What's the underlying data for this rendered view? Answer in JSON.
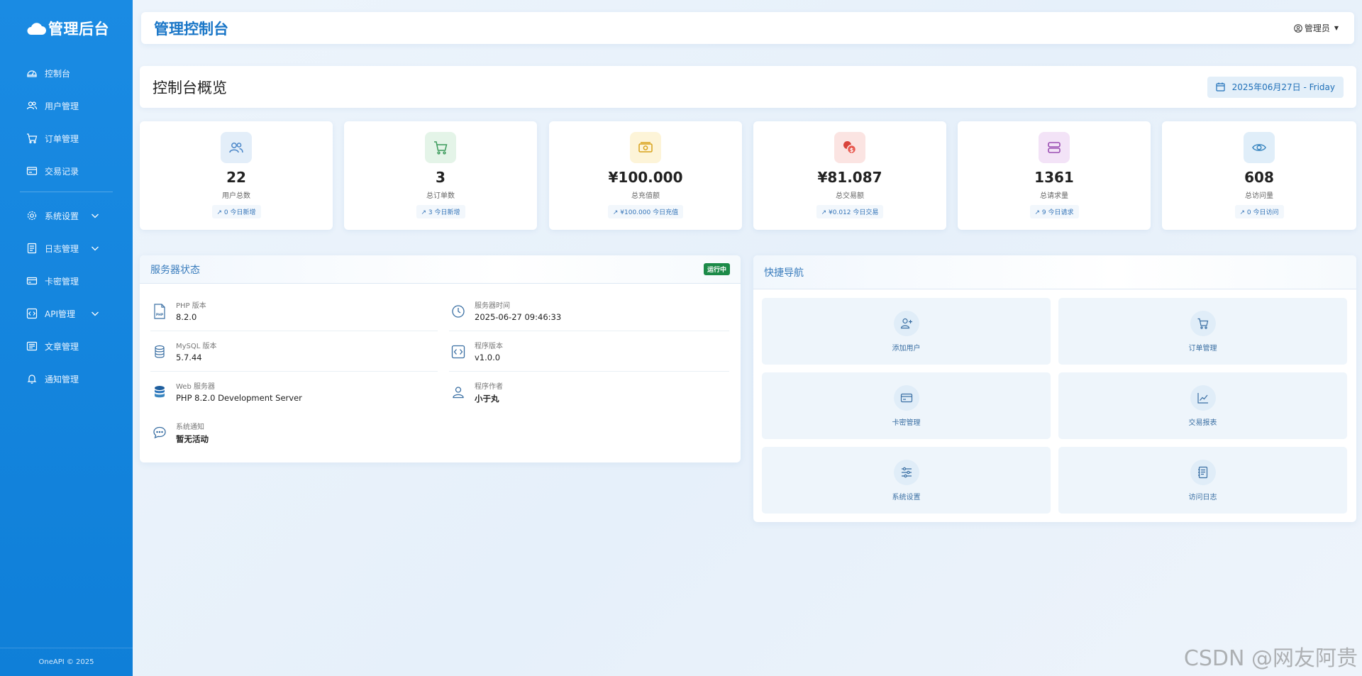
{
  "brand": {
    "title": "管理后台"
  },
  "sidebar": {
    "items": [
      {
        "label": "控制台",
        "icon": "dashboard-icon"
      },
      {
        "label": "用户管理",
        "icon": "users-icon"
      },
      {
        "label": "订单管理",
        "icon": "cart-icon"
      },
      {
        "label": "交易记录",
        "icon": "transaction-icon"
      },
      {
        "label": "系统设置",
        "icon": "gear-icon",
        "expandable": true
      },
      {
        "label": "日志管理",
        "icon": "log-icon",
        "expandable": true
      },
      {
        "label": "卡密管理",
        "icon": "card-icon"
      },
      {
        "label": "API管理",
        "icon": "api-icon",
        "expandable": true
      },
      {
        "label": "文章管理",
        "icon": "article-icon"
      },
      {
        "label": "通知管理",
        "icon": "bell-icon"
      }
    ],
    "footer": "OneAPI © 2025"
  },
  "topbar": {
    "title": "管理控制台",
    "user": "管理员"
  },
  "page": {
    "title": "控制台概览",
    "date": "2025年06月27日 - Friday"
  },
  "stats": [
    {
      "value": "22",
      "label": "用户总数",
      "trend": "↗ 0 今日新增",
      "icon": "users-icon",
      "color": "#4a86c8",
      "bg": "#e3eef9"
    },
    {
      "value": "3",
      "label": "总订单数",
      "trend": "↗ 3 今日新增",
      "icon": "cart-icon",
      "color": "#3a9a5a",
      "bg": "#e4f4e8"
    },
    {
      "value": "¥100.000",
      "label": "总充值额",
      "trend": "↗ ¥100.000 今日充值",
      "icon": "money-icon",
      "color": "#d8a21a",
      "bg": "#fdf4d8"
    },
    {
      "value": "¥81.087",
      "label": "总交易额",
      "trend": "↗ ¥0.012 今日交易",
      "icon": "coins-icon",
      "color": "#d9443b",
      "bg": "#fbe4e2"
    },
    {
      "value": "1361",
      "label": "总请求量",
      "trend": "↗ 9 今日请求",
      "icon": "server-icon",
      "color": "#9b4fb3",
      "bg": "#f3e3f7"
    },
    {
      "value": "608",
      "label": "总访问量",
      "trend": "↗ 0 今日访问",
      "icon": "eye-icon",
      "color": "#3a86c0",
      "bg": "#e0eef9"
    }
  ],
  "server": {
    "title": "服务器状态",
    "status": "运行中",
    "items": [
      {
        "label": "PHP 版本",
        "value": "8.2.0",
        "icon": "php-icon"
      },
      {
        "label": "服务器时间",
        "value": "2025-06-27 09:46:33",
        "icon": "clock-icon"
      },
      {
        "label": "MySQL 版本",
        "value": "5.7.44",
        "icon": "database-icon"
      },
      {
        "label": "程序版本",
        "value": "v1.0.0",
        "icon": "code-icon"
      },
      {
        "label": "Web 服务器",
        "value": "PHP 8.2.0 Development Server",
        "icon": "server-stack-icon"
      },
      {
        "label": "程序作者",
        "value": "小于丸",
        "icon": "person-icon"
      },
      {
        "label": "系统通知",
        "value": "暂无活动",
        "icon": "chat-icon"
      }
    ]
  },
  "quicknav": {
    "title": "快捷导航",
    "items": [
      {
        "label": "添加用户",
        "icon": "add-user-icon"
      },
      {
        "label": "订单管理",
        "icon": "cart-icon"
      },
      {
        "label": "卡密管理",
        "icon": "card-icon"
      },
      {
        "label": "交易报表",
        "icon": "chart-line-icon"
      },
      {
        "label": "系统设置",
        "icon": "sliders-icon"
      },
      {
        "label": "访问日志",
        "icon": "journal-icon"
      }
    ]
  },
  "watermark": "CSDN @网友阿贵"
}
